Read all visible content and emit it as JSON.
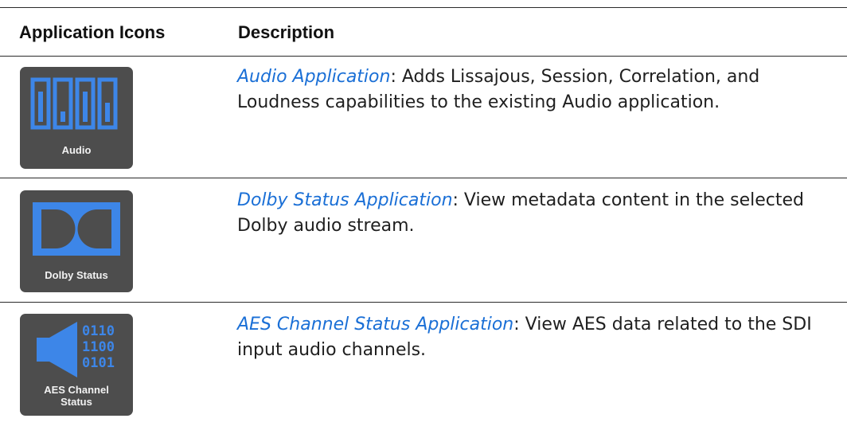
{
  "table": {
    "headers": {
      "icons": "Application Icons",
      "description": "Description"
    },
    "rows": [
      {
        "icon_name": "audio-meters-icon",
        "icon_caption": "Audio",
        "link_text": "Audio Application",
        "description": ": Adds Lissajous, Session, Correlation, and Loudness capabilities to the existing Audio application."
      },
      {
        "icon_name": "dolby-logo-icon",
        "icon_caption": "Dolby Status",
        "link_text": "Dolby Status Application",
        "description": ": View metadata content in the selected Dolby audio stream."
      },
      {
        "icon_name": "speaker-binary-icon",
        "icon_caption_line1": "AES Channel",
        "icon_caption_line2": "Status",
        "icon_binary": [
          "0110",
          "1100",
          "0101"
        ],
        "link_text": "AES Channel Status Application",
        "description": ": View AES data related to the SDI input audio channels."
      }
    ]
  },
  "colors": {
    "tile_background": "#4d4d4d",
    "icon_blue": "#3d86e8",
    "link_blue": "#1a6fd6",
    "rule": "#2a2a2a"
  }
}
